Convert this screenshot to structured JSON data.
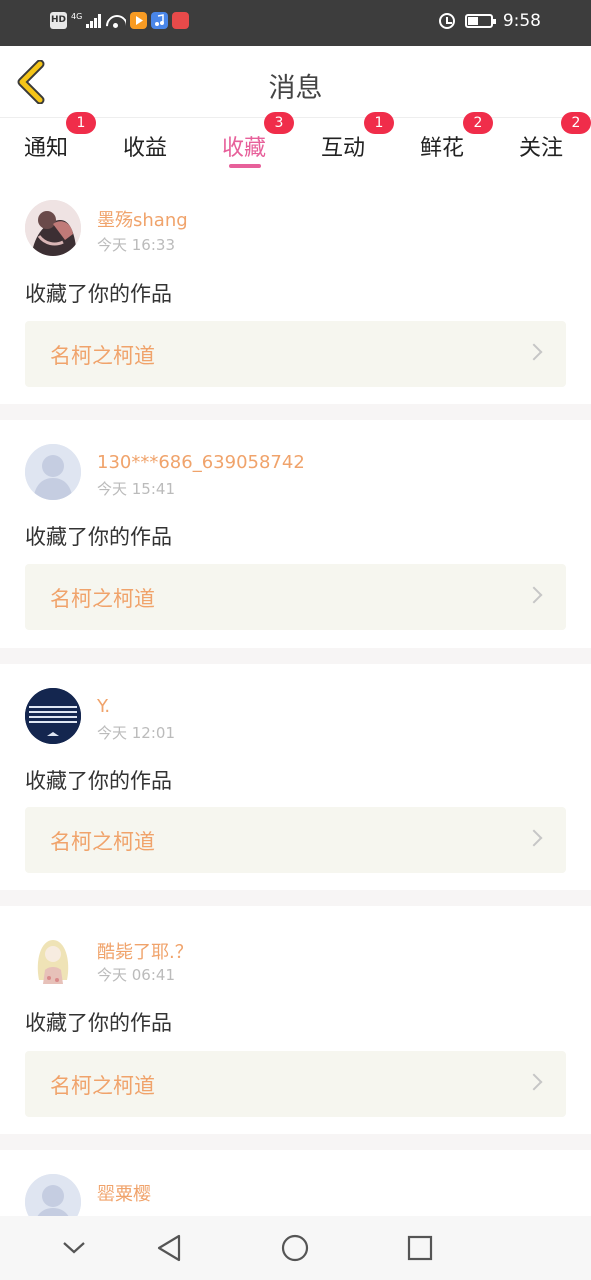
{
  "status_bar": {
    "hd_label": "HD",
    "network_label": "4G",
    "time": "9:58",
    "icons": [
      "signal-icon",
      "wifi-icon",
      "video-app-icon",
      "music-app-icon",
      "red-app-icon",
      "alarm-icon",
      "battery-icon"
    ]
  },
  "header": {
    "title": "消息",
    "back_icon": "chevron-left-icon",
    "back_color": "#f5c518"
  },
  "tabs": [
    {
      "label": "通知",
      "badge": "1"
    },
    {
      "label": "收益",
      "badge": ""
    },
    {
      "label": "收藏",
      "badge": "3",
      "active": true
    },
    {
      "label": "互动",
      "badge": "1"
    },
    {
      "label": "鲜花",
      "badge": "2"
    },
    {
      "label": "关注",
      "badge": "2"
    }
  ],
  "colors": {
    "accent": "#e7609a",
    "badge": "#f02d4a",
    "username": "#f0a36b"
  },
  "feed": [
    {
      "username": "墨殇shang",
      "time": "今天 16:33",
      "action": "收藏了你的作品",
      "work_title": "名柯之柯道",
      "avatar": "illustrated-girl-avatar"
    },
    {
      "username": "130***686_639058742",
      "time": "今天 15:41",
      "action": "收藏了你的作品",
      "work_title": "名柯之柯道",
      "avatar": "default-avatar"
    },
    {
      "username": "Y.",
      "time": "今天 12:01",
      "action": "收藏了你的作品",
      "work_title": "名柯之柯道",
      "avatar": "navy-stripes-avatar"
    },
    {
      "username": "酷毙了耶.？",
      "time": "今天 06:41",
      "action": "收藏了你的作品",
      "work_title": "名柯之柯道",
      "avatar": "blonde-girl-avatar"
    },
    {
      "username": "罂粟樱",
      "time": "",
      "action": "",
      "work_title": "",
      "avatar": "default-avatar"
    }
  ],
  "nav_bar": {
    "buttons": [
      "collapse-chevron-icon",
      "back-triangle-icon",
      "home-circle-icon",
      "recents-square-icon"
    ]
  }
}
